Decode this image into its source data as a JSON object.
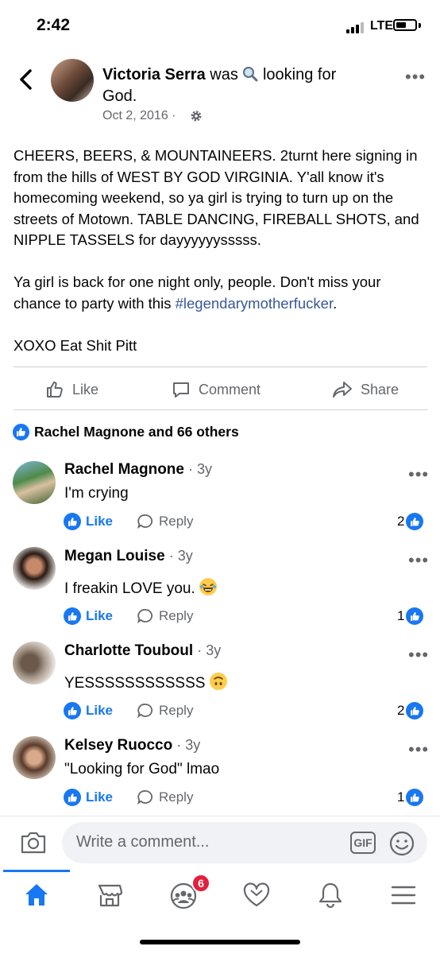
{
  "status_bar": {
    "time": "2:42",
    "network": "LTE"
  },
  "post": {
    "author": "Victoria Serra",
    "activity_prefix": "was",
    "activity": "looking for God.",
    "date": "Oct 2, 2016",
    "date_separator": "·",
    "paragraphs": [
      "CHEERS, BEERS, & MOUNTAINEERS. 2turnt here signing in from the hills of WEST BY GOD VIRGINIA. Y'all know it's homecoming weekend, so ya girl is trying to turn up on the streets of Motown. TABLE DANCING, FIREBALL SHOTS, and NIPPLE TASSELS for dayyyyyysssss."
    ],
    "paragraph2_before": "Ya girl is back for one night only, people. Don't miss your chance to party with this ",
    "hashtag": "#legendarymotherfucker",
    "paragraph2_after": ".",
    "signoff": "XOXO Eat Shit Pitt"
  },
  "actions": {
    "like": "Like",
    "comment": "Comment",
    "share": "Share"
  },
  "reactions_summary": "Rachel Magnone and 66 others",
  "comments": [
    {
      "name": "Rachel Magnone",
      "time": "3y",
      "text": "I'm crying",
      "like": "Like",
      "reply": "Reply",
      "likes": "2",
      "emoji": ""
    },
    {
      "name": "Megan Louise",
      "time": "3y",
      "text": "I freakin LOVE you.",
      "like": "Like",
      "reply": "Reply",
      "likes": "1",
      "emoji": "laughing-emoji"
    },
    {
      "name": "Charlotte Touboul",
      "time": "3y",
      "text": "YESSSSSSSSSSSS",
      "like": "Like",
      "reply": "Reply",
      "likes": "2",
      "emoji": "upside-down-face-emoji"
    },
    {
      "name": "Kelsey Ruocco",
      "time": "3y",
      "text": "\"Looking for God\" lmao",
      "like": "Like",
      "reply": "Reply",
      "likes": "1",
      "emoji": ""
    }
  ],
  "composer": {
    "placeholder": "Write a comment...",
    "gif": "GIF"
  },
  "tab_bar": {
    "groups_badge": "6"
  },
  "colors": {
    "accent": "#1877f2",
    "muted": "#65676b",
    "badge": "#e41e3f",
    "hashtag": "#385898"
  }
}
